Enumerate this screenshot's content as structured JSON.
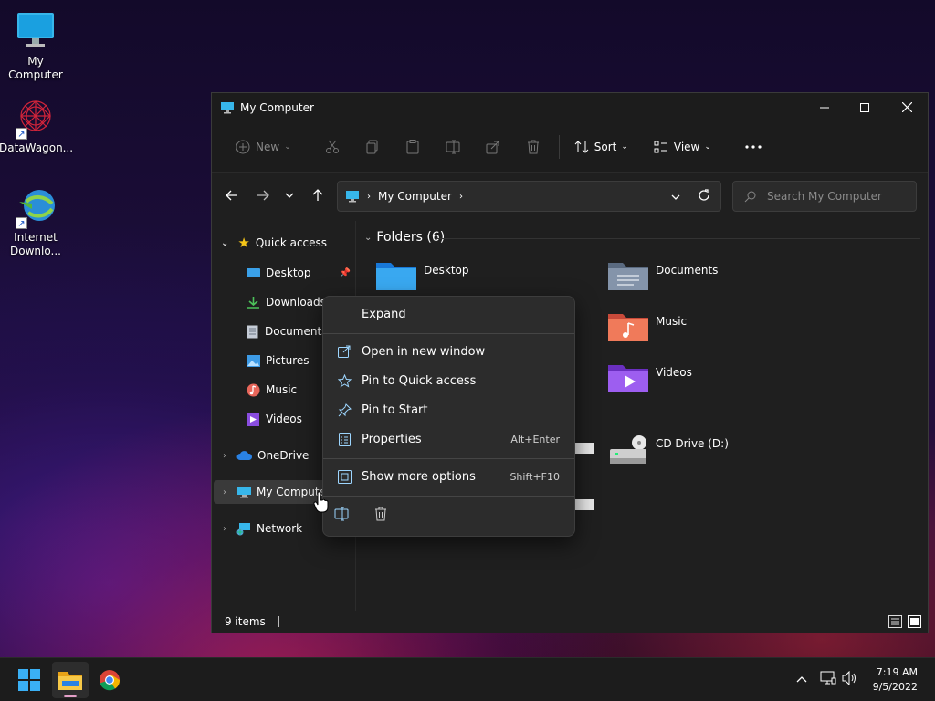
{
  "desktop": {
    "icons": [
      {
        "label": "My Computer"
      },
      {
        "label": "DataWagon..."
      },
      {
        "label_line1": "Internet",
        "label_line2": "Downlo..."
      }
    ]
  },
  "window": {
    "title": "My Computer",
    "toolbar": {
      "new_label": "New",
      "sort_label": "Sort",
      "view_label": "View"
    },
    "address": {
      "segment": "My Computer"
    },
    "search": {
      "placeholder": "Search My Computer"
    },
    "sidebar": {
      "quick_access": "Quick access",
      "items": [
        "Desktop",
        "Downloads",
        "Documents",
        "Pictures",
        "Music",
        "Videos"
      ],
      "onedrive": "OneDrive",
      "my_computer": "My Compute",
      "network": "Network"
    },
    "content": {
      "folders_header": "Folders (6)",
      "folders": [
        "Desktop",
        "Documents",
        "Music",
        "Videos"
      ],
      "drive": "CD Drive (D:)"
    },
    "status": {
      "items": "9 items"
    }
  },
  "context_menu": {
    "expand": "Expand",
    "open_new_window": "Open in new window",
    "pin_quick": "Pin to Quick access",
    "pin_start": "Pin to Start",
    "properties": "Properties",
    "properties_shortcut": "Alt+Enter",
    "more_options": "Show more options",
    "more_options_shortcut": "Shift+F10"
  },
  "taskbar": {
    "time": "7:19 AM",
    "date": "9/5/2022"
  },
  "colors": {
    "accent": "#60cdff",
    "folder_blue": "#1e90ff",
    "window_bg": "#1f1f1f"
  }
}
